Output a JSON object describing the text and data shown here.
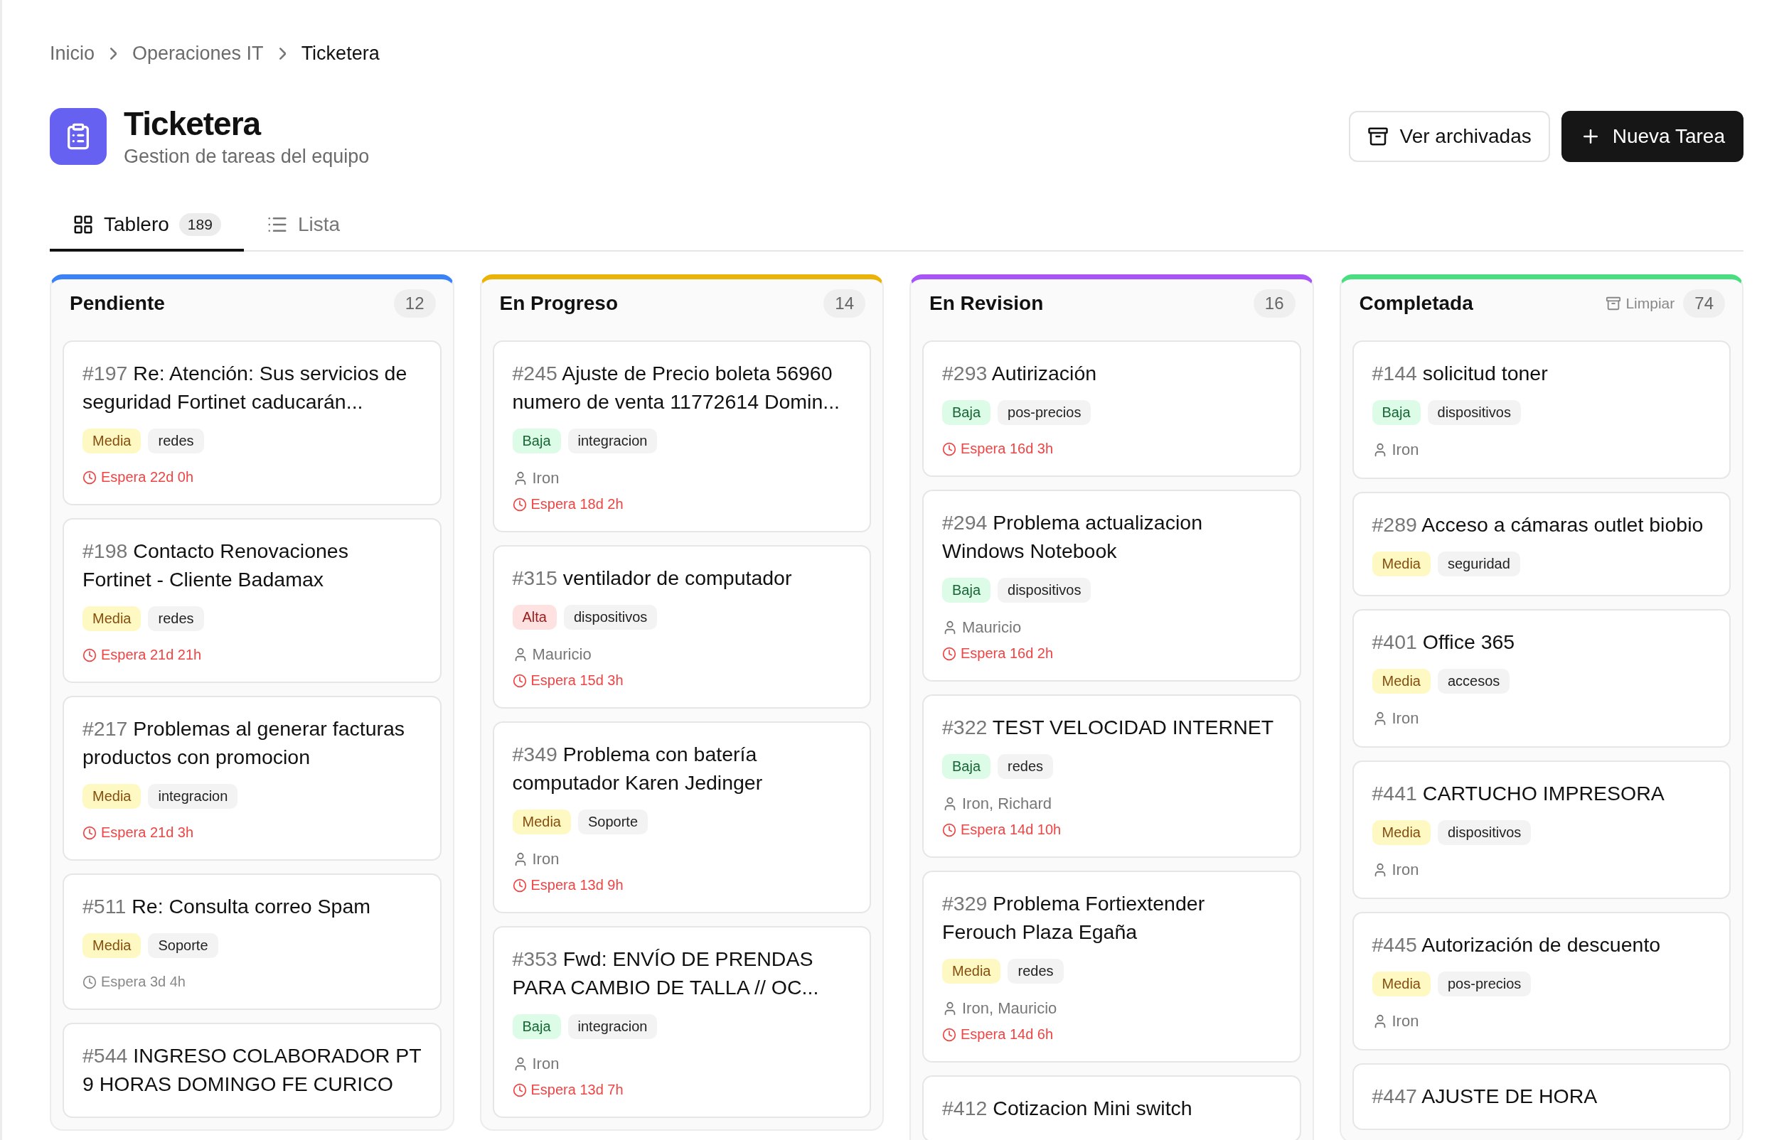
{
  "breadcrumb": [
    {
      "label": "Inicio",
      "current": false
    },
    {
      "label": "Operaciones IT",
      "current": false
    },
    {
      "label": "Ticketera",
      "current": true
    }
  ],
  "header": {
    "title": "Ticketera",
    "subtitle": "Gestion de tareas del equipo",
    "buttons": [
      {
        "label": "Ver archivadas",
        "kind": "archive"
      },
      {
        "label": "Nueva Tarea",
        "kind": "new"
      }
    ]
  },
  "tabs": [
    {
      "label": "Tablero",
      "kind": "board",
      "count": "189",
      "selected": true
    },
    {
      "label": "Lista",
      "kind": "list",
      "selected": false
    }
  ],
  "columns": [
    {
      "title": "Pendiente",
      "color": "#3b82f6",
      "count": "12",
      "cards": [
        {
          "number": "#197",
          "title": "Re: Atención: Sus servicios de seguridad Fortinet caducarán...",
          "priority": {
            "label": "Media",
            "kind": "media"
          },
          "tag": "redes",
          "wait": {
            "text": "Espera 22d 0h",
            "overdue": true
          }
        },
        {
          "number": "#198",
          "title": "Contacto Renovaciones Fortinet - Cliente Badamax",
          "priority": {
            "label": "Media",
            "kind": "media"
          },
          "tag": "redes",
          "wait": {
            "text": "Espera 21d 21h",
            "overdue": true
          }
        },
        {
          "number": "#217",
          "title": "Problemas al generar facturas productos con promocion",
          "priority": {
            "label": "Media",
            "kind": "media"
          },
          "tag": "integracion",
          "wait": {
            "text": "Espera 21d 3h",
            "overdue": true
          }
        },
        {
          "number": "#511",
          "title": "Re: Consulta correo Spam",
          "priority": {
            "label": "Media",
            "kind": "media"
          },
          "tag": "Soporte",
          "wait": {
            "text": "Espera 3d 4h",
            "overdue": false
          }
        },
        {
          "number": "#544",
          "title": "INGRESO COLABORADOR PT 9 HORAS DOMINGO FE CURICO"
        }
      ]
    },
    {
      "title": "En Progreso",
      "color": "#eab308",
      "count": "14",
      "cards": [
        {
          "number": "#245",
          "title": "Ajuste de Precio boleta 56960 numero de venta 11772614 Domin...",
          "priority": {
            "label": "Baja",
            "kind": "baja"
          },
          "tag": "integracion",
          "assignee": "Iron",
          "wait": {
            "text": "Espera 18d 2h",
            "overdue": true
          }
        },
        {
          "number": "#315",
          "title": "ventilador de computador",
          "priority": {
            "label": "Alta",
            "kind": "alta"
          },
          "tag": "dispositivos",
          "assignee": "Mauricio",
          "wait": {
            "text": "Espera 15d 3h",
            "overdue": true
          }
        },
        {
          "number": "#349",
          "title": "Problema con batería computador Karen Jedinger",
          "priority": {
            "label": "Media",
            "kind": "media"
          },
          "tag": "Soporte",
          "assignee": "Iron",
          "wait": {
            "text": "Espera 13d 9h",
            "overdue": true
          }
        },
        {
          "number": "#353",
          "title": "Fwd: ENVÍO DE PRENDAS PARA CAMBIO DE TALLA // OC...",
          "priority": {
            "label": "Baja",
            "kind": "baja"
          },
          "tag": "integracion",
          "assignee": "Iron",
          "wait": {
            "text": "Espera 13d 7h",
            "overdue": true
          }
        }
      ]
    },
    {
      "title": "En Revision",
      "color": "#a855f7",
      "count": "16",
      "cards": [
        {
          "number": "#293",
          "title": "Autirización",
          "priority": {
            "label": "Baja",
            "kind": "baja"
          },
          "tag": "pos-precios",
          "wait": {
            "text": "Espera 16d 3h",
            "overdue": true
          }
        },
        {
          "number": "#294",
          "title": "Problema actualizacion Windows Notebook",
          "priority": {
            "label": "Baja",
            "kind": "baja"
          },
          "tag": "dispositivos",
          "assignee": "Mauricio",
          "wait": {
            "text": "Espera 16d 2h",
            "overdue": true
          }
        },
        {
          "number": "#322",
          "title": "TEST VELOCIDAD INTERNET",
          "priority": {
            "label": "Baja",
            "kind": "baja"
          },
          "tag": "redes",
          "assignee": "Iron, Richard",
          "wait": {
            "text": "Espera 14d 10h",
            "overdue": true
          }
        },
        {
          "number": "#329",
          "title": "Problema Fortiextender Ferouch Plaza Egaña",
          "priority": {
            "label": "Media",
            "kind": "media"
          },
          "tag": "redes",
          "assignee": "Iron, Mauricio",
          "wait": {
            "text": "Espera 14d 6h",
            "overdue": true
          }
        },
        {
          "number": "#412",
          "title": "Cotizacion Mini switch"
        }
      ]
    },
    {
      "title": "Completada",
      "color": "#4ade80",
      "count": "74",
      "action": "Limpiar",
      "cards": [
        {
          "number": "#144",
          "title": "solicitud toner",
          "priority": {
            "label": "Baja",
            "kind": "baja"
          },
          "tag": "dispositivos",
          "assignee": "Iron"
        },
        {
          "number": "#289",
          "title": "Acceso a cámaras outlet biobio",
          "priority": {
            "label": "Media",
            "kind": "media"
          },
          "tag": "seguridad"
        },
        {
          "number": "#401",
          "title": "Office 365",
          "priority": {
            "label": "Media",
            "kind": "media"
          },
          "tag": "accesos",
          "assignee": "Iron"
        },
        {
          "number": "#441",
          "title": "CARTUCHO IMPRESORA",
          "priority": {
            "label": "Media",
            "kind": "media"
          },
          "tag": "dispositivos",
          "assignee": "Iron"
        },
        {
          "number": "#445",
          "title": "Autorización de descuento",
          "priority": {
            "label": "Media",
            "kind": "media"
          },
          "tag": "pos-precios",
          "assignee": "Iron"
        },
        {
          "number": "#447",
          "title": "AJUSTE DE HORA"
        }
      ]
    }
  ]
}
